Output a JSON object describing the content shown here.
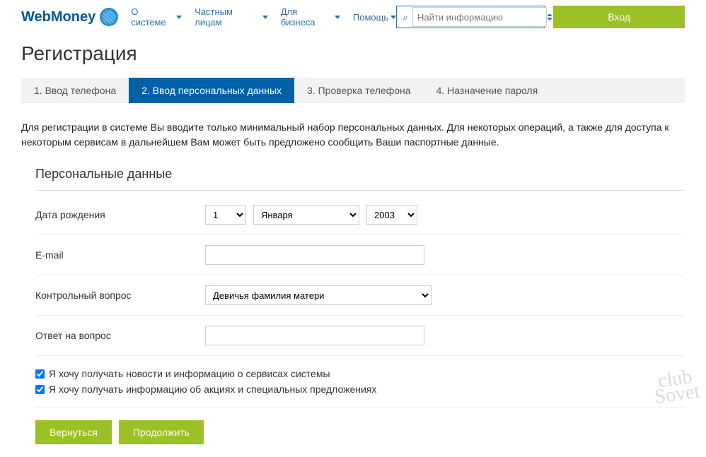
{
  "header": {
    "logo": "WebMoney",
    "nav": [
      "О системе",
      "Частным лицам",
      "Для бизнеса",
      "Помощь"
    ],
    "search_placeholder": "Найти информацию",
    "login": "Вход"
  },
  "page_title": "Регистрация",
  "steps": [
    "1. Ввод телефона",
    "2. Ввод персональных данных",
    "3. Проверка телефона",
    "4. Назначение пароля"
  ],
  "intro": "Для регистрации в системе Вы вводите только минимальный набор персональных данных. Для некоторых операций, а также для доступа к некоторым сервисам в дальнейшем Вам может быть предложено сообщить Ваши паспортные данные.",
  "form": {
    "title": "Персональные данные",
    "dob_label": "Дата рождения",
    "dob_day": "1",
    "dob_month": "Января",
    "dob_year": "2003",
    "email_label": "E-mail",
    "email_value": "",
    "question_label": "Контрольный вопрос",
    "question_value": "Девичья фамилия матери",
    "answer_label": "Ответ на вопрос",
    "answer_value": "",
    "check1": "Я хочу получать новости и информацию о сервисах системы",
    "check2": "Я хочу получать информацию об акциях и специальных предложениях",
    "back": "Вернуться",
    "continue": "Продолжить"
  },
  "watermark": "club\nSovet"
}
